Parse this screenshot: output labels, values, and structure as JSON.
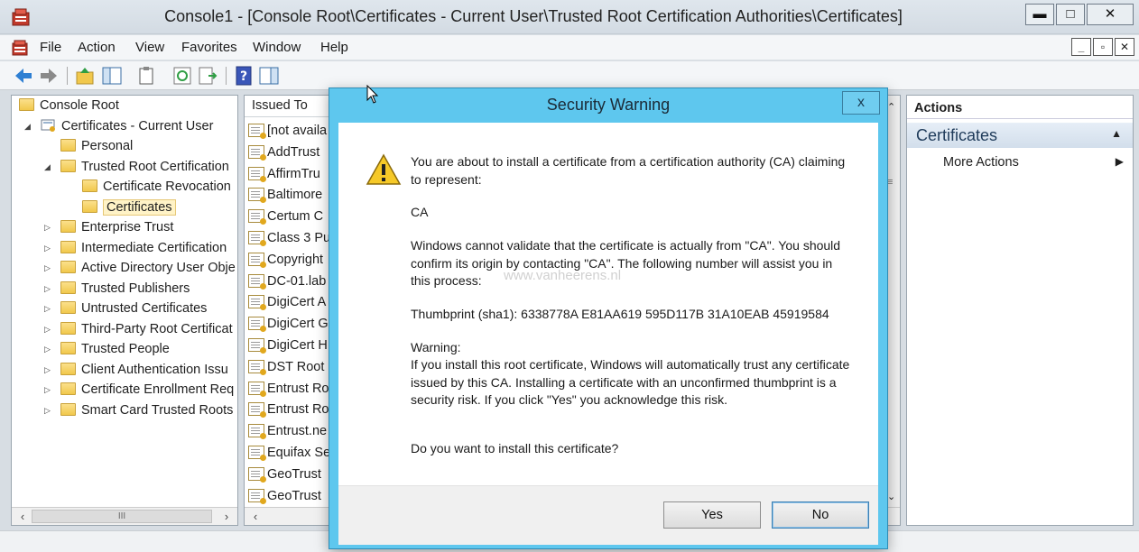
{
  "window": {
    "title": "Console1 - [Console Root\\Certificates - Current User\\Trusted Root Certification Authorities\\Certificates]",
    "minimize": "▬",
    "maximize": "□",
    "close": "✕"
  },
  "menu": {
    "items": [
      "File",
      "Action",
      "View",
      "Favorites",
      "Window",
      "Help"
    ],
    "mdi_minimize": "_",
    "mdi_restore": "▫",
    "mdi_close": "✕"
  },
  "tree": {
    "root": "Console Root",
    "store": "Certificates - Current User",
    "items": [
      "Personal",
      "Trusted Root Certification",
      "Certificate Revocation",
      "Certificates",
      "Enterprise Trust",
      "Intermediate Certification",
      "Active Directory User Obje",
      "Trusted Publishers",
      "Untrusted Certificates",
      "Third-Party Root Certificat",
      "Trusted People",
      "Client Authentication Issu",
      "Certificate Enrollment Req",
      "Smart Card Trusted Roots"
    ],
    "scroll_thumb": "III"
  },
  "list": {
    "column": "Issued To",
    "rows": [
      "[not availa",
      "AddTrust",
      "AffirmTru",
      "Baltimore",
      "Certum C",
      "Class 3 Pu",
      "Copyright",
      "DC-01.lab",
      "DigiCert A",
      "DigiCert G",
      "DigiCert H",
      "DST Root",
      "Entrust Ro",
      "Entrust Ro",
      "Entrust.ne",
      "Equifax Se",
      "GeoTrust",
      "GeoTrust"
    ]
  },
  "actions": {
    "header": "Actions",
    "section": "Certificates",
    "more": "More Actions"
  },
  "dialog": {
    "title": "Security Warning",
    "close": "x",
    "para1": "You are about to install a certificate from a certification authority (CA) claiming to represent:",
    "ca_name": "CA",
    "para2": "Windows cannot validate that the certificate is actually from \"CA\". You should confirm its origin by contacting \"CA\". The following number will assist you in this process:",
    "thumbprint": "Thumbprint (sha1): 6338778A E81AA619 595D117B 31A10EAB 45919584",
    "warning_label": "Warning:",
    "warning_text": "If you install this root certificate, Windows will automatically trust any certificate issued by this CA. Installing a certificate with an unconfirmed thumbprint is a security risk. If you click \"Yes\" you acknowledge this risk.",
    "question": "Do you want to install this certificate?",
    "yes": "Yes",
    "no": "No"
  },
  "watermark": "www.vanheerens.nl",
  "colors": {
    "dialog_frame": "#5ec7ee",
    "selection": "#fff3c7",
    "folder": "#f1c84c"
  }
}
